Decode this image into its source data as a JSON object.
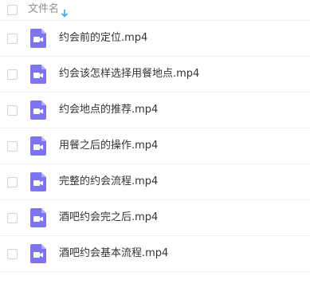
{
  "header": {
    "column_label": "文件名",
    "sort_icon": "arrow-down-icon"
  },
  "colors": {
    "video_icon_bg": "#7e74f1",
    "sort_arrow": "#3aa0ff"
  },
  "files": [
    {
      "name": "约会前的定位.mp4",
      "icon": "video-file-icon"
    },
    {
      "name": "约会该怎样选择用餐地点.mp4",
      "icon": "video-file-icon"
    },
    {
      "name": "约会地点的推荐.mp4",
      "icon": "video-file-icon"
    },
    {
      "name": "用餐之后的操作.mp4",
      "icon": "video-file-icon"
    },
    {
      "name": "完整的约会流程.mp4",
      "icon": "video-file-icon"
    },
    {
      "name": "酒吧约会完之后.mp4",
      "icon": "video-file-icon"
    },
    {
      "name": "酒吧约会基本流程.mp4",
      "icon": "video-file-icon"
    }
  ]
}
